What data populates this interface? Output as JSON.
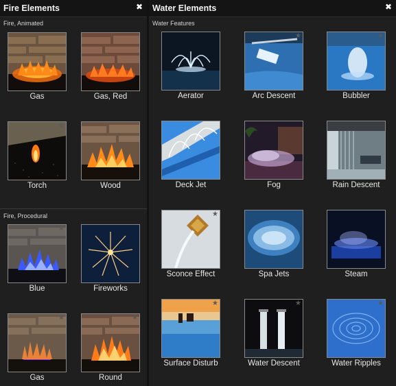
{
  "fire_panel": {
    "title": "Fire Elements",
    "close_glyph": "✖",
    "sections": [
      {
        "label": "Fire, Animated",
        "items": [
          {
            "label": "Gas",
            "starred": false
          },
          {
            "label": "Gas, Red",
            "starred": false
          },
          {
            "label": "Torch",
            "starred": true
          },
          {
            "label": "Wood",
            "starred": false
          }
        ]
      },
      {
        "label": "Fire, Procedural",
        "items": [
          {
            "label": "Blue",
            "starred": true
          },
          {
            "label": "Fireworks",
            "starred": false
          },
          {
            "label": "Gas",
            "starred": true
          },
          {
            "label": "Round",
            "starred": true
          }
        ]
      }
    ]
  },
  "water_panel": {
    "title": "Water Elements",
    "close_glyph": "✖",
    "sections": [
      {
        "label": "Water Features",
        "items": [
          {
            "label": "Aerator",
            "starred": false
          },
          {
            "label": "Arc Descent",
            "starred": true
          },
          {
            "label": "Bubbler",
            "starred": true
          },
          {
            "label": "Deck Jet",
            "starred": false
          },
          {
            "label": "Fog",
            "starred": false
          },
          {
            "label": "Rain Descent",
            "starred": false
          },
          {
            "label": "Sconce Effect",
            "starred": true
          },
          {
            "label": "Spa Jets",
            "starred": false
          },
          {
            "label": "Steam",
            "starred": false
          },
          {
            "label": "Surface Disturb",
            "starred": true
          },
          {
            "label": "Water Descent",
            "starred": true
          },
          {
            "label": "Water Ripples",
            "starred": true
          }
        ]
      }
    ]
  },
  "icons": {
    "star": "star-icon",
    "close": "close-icon"
  }
}
